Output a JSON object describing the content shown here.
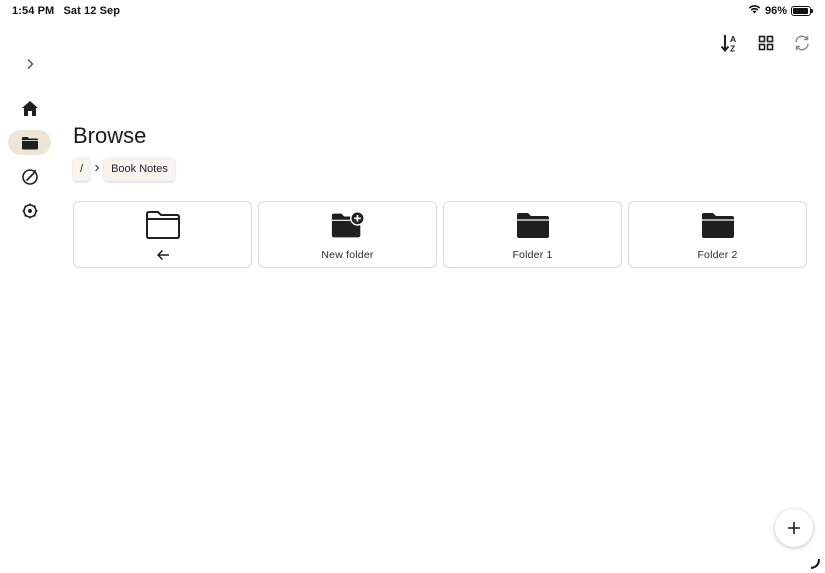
{
  "status_bar": {
    "time": "1:54 PM",
    "date": "Sat 12 Sep",
    "battery": "96%",
    "battery_level": 0.96,
    "wifi_icon": "wifi-icon",
    "battery_icon": "battery-icon"
  },
  "toolbar": {
    "sort_icon": "sort-az-icon",
    "grid_icon": "grid-view-icon",
    "sync_icon": "sync-icon"
  },
  "sidebar": {
    "items": [
      {
        "icon": "chevron-right-icon",
        "active": false
      },
      {
        "icon": "home-icon",
        "active": false
      },
      {
        "icon": "folder-icon",
        "active": true
      },
      {
        "icon": "compass-icon",
        "active": false
      },
      {
        "icon": "gear-icon",
        "active": false
      }
    ]
  },
  "main": {
    "title": "Browse",
    "breadcrumb": {
      "root": "/",
      "current": "Book Notes"
    },
    "items": [
      {
        "label": "",
        "icon": "folder-outline-icon",
        "sub_icon": "arrow-left-icon"
      },
      {
        "label": "New folder",
        "icon": "folder-plus-icon"
      },
      {
        "label": "Folder 1",
        "icon": "folder-icon"
      },
      {
        "label": "Folder 2",
        "icon": "folder-icon"
      }
    ]
  },
  "fab": {
    "icon": "plus-icon"
  },
  "colors": {
    "active_bg": "#ece6d8",
    "icon": "#1f1f1f",
    "card_border": "#dcdcdc"
  }
}
